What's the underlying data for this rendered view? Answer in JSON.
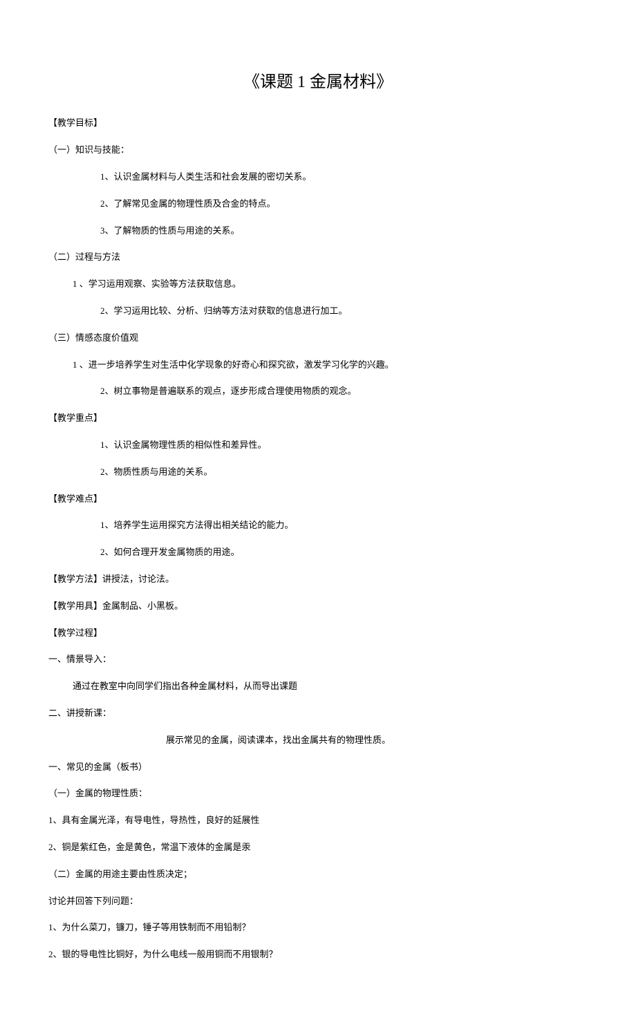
{
  "title": "《课题 1 金属材料》",
  "sections": {
    "goal": {
      "label": "【教学目标】",
      "part1": {
        "heading": "（一）知识与技能：",
        "items": [
          "1、认识金属材料与人类生活和社会发展的密切关系。",
          "2、了解常见金属的物理性质及合金的特点。",
          "3、了解物质的性质与用途的关系。"
        ]
      },
      "part2": {
        "heading": "（二）过程与方法",
        "item1": "1 、学习运用观察、实验等方法获取信息。",
        "item2": "2、学习运用比较、分析、归纳等方法对获取的信息进行加工。"
      },
      "part3": {
        "heading": "（三）情感态度价值观",
        "item1": "1 、进一步培养学生对生活中化学现象的好奇心和探究欲，激发学习化学的兴趣。",
        "item2": "2、树立事物是普遍联系的观点，逐步形成合理使用物质的观念。"
      }
    },
    "keypoint": {
      "label": "【教学重点】",
      "items": [
        "1、认识金属物理性质的相似性和差异性。",
        "2、物质性质与用途的关系。"
      ]
    },
    "difficulty": {
      "label": "【教学难点】",
      "items": [
        "1、培养学生运用探究方法得出相关结论的能力。",
        "2、如何合理开发金属物质的用途。"
      ]
    },
    "method": "【教学方法】讲授法，讨论法。",
    "tools": "【教学用具】金属制品、小黑板。",
    "process": {
      "label": "【教学过程】",
      "part1": {
        "heading": "一、情景导入：",
        "content": "通过在教室中向同学们指出各种金属材料，从而导出课题"
      },
      "part2": {
        "heading": "二、讲授新课：",
        "center_text": "展示常见的金属，阅读课本，找出金属共有的物理性质。",
        "line1": "一、常见的金属（板书）",
        "line2": "（一）金属的物理性质：",
        "line3": "1、具有金属光泽，有导电性，导热性，良好的延展性",
        "line4": "2、铜是紫红色，金是黄色，常温下液体的金属是汞",
        "line5": "（二）金属的用途主要由性质决定；",
        "line6": "讨论并回答下列问题：",
        "line7": "1、为什么菜刀，镰刀，锤子等用铁制而不用铅制？",
        "line8": "2、银的导电性比铜好，为什么电线一般用铜而不用银制？"
      }
    }
  }
}
